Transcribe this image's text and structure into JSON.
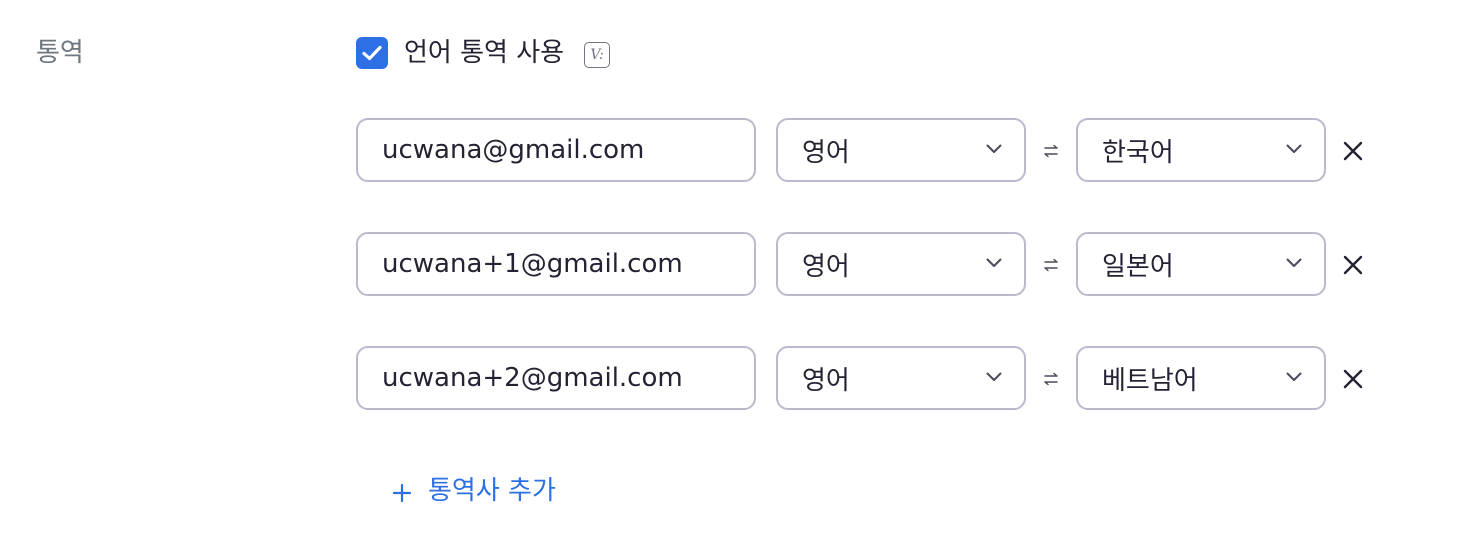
{
  "section": {
    "label": "통역"
  },
  "enable": {
    "checked": true,
    "label": "언어 통역 사용",
    "badge_icon": "v-badge-icon",
    "badge_text": "V:"
  },
  "interpreters": [
    {
      "email": "ucwana@gmail.com",
      "from_language": "영어",
      "to_language": "한국어"
    },
    {
      "email": "ucwana+1@gmail.com",
      "from_language": "영어",
      "to_language": "일본어"
    },
    {
      "email": "ucwana+2@gmail.com",
      "from_language": "영어",
      "to_language": "베트남어"
    }
  ],
  "add_interpreter": {
    "label": "통역사 추가",
    "icon": "plus-icon"
  },
  "colors": {
    "accent": "#2d6fe4",
    "border": "#babacc",
    "muted_text": "#6e7680",
    "text": "#232333"
  }
}
